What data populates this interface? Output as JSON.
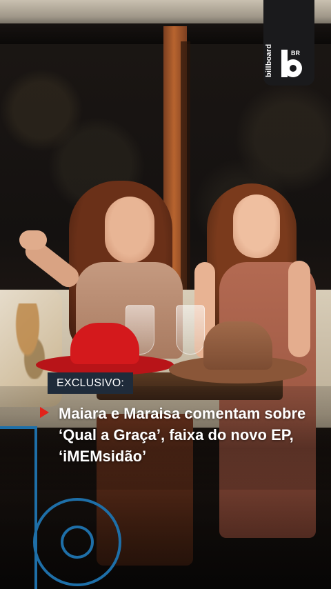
{
  "brand": {
    "logo_word": "billboard",
    "logo_region": "BR",
    "accent_red": "#e2231a",
    "label_bg": "#1f2b3a",
    "outline_blue": "#1e6fa8"
  },
  "post": {
    "label": "EXCLUSIVO:",
    "headline": "Maiara e Maraisa comentam sobre ‘Qual a Graça’, faixa do novo EP, ‘iMEMsidão’"
  },
  "icons": {
    "logo": "billboard-br-logo-icon",
    "bullet": "play-triangle-icon",
    "watermark": "billboard-b-outline-icon"
  }
}
